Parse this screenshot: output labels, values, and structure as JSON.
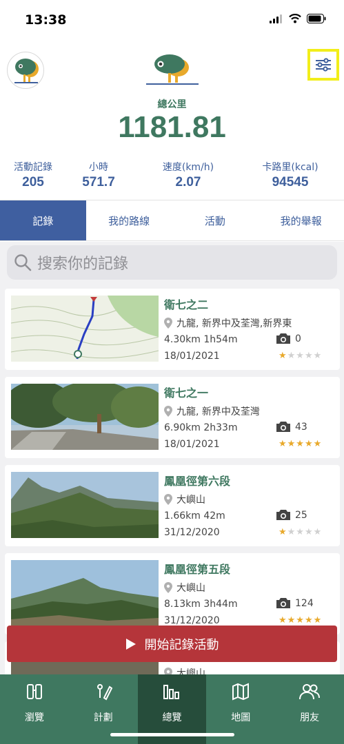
{
  "status": {
    "time": "13:38"
  },
  "summary": {
    "total_label": "總公里",
    "total_value": "1181.81",
    "stats": [
      {
        "label": "活動記錄",
        "value": "205"
      },
      {
        "label": "小時",
        "value": "571.7"
      },
      {
        "label": "速度(km/h)",
        "value": "2.07"
      },
      {
        "label": "卡路里(kcal)",
        "value": "94545"
      }
    ]
  },
  "tabs": [
    "記錄",
    "我的路線",
    "活動",
    "我的舉報"
  ],
  "search": {
    "placeholder": "搜索你的記錄"
  },
  "records": [
    {
      "title": "衛七之二",
      "location": "九龍, 新界中及荃灣,新界東",
      "distance_time": "4.30km  1h54m",
      "photos": "0",
      "date": "18/01/2021",
      "rating": 1
    },
    {
      "title": "衛七之一",
      "location": "九龍, 新界中及荃灣",
      "distance_time": "6.90km  2h33m",
      "photos": "43",
      "date": "18/01/2021",
      "rating": 5
    },
    {
      "title": "鳳凰徑第六段",
      "location": "大嶼山",
      "distance_time": "1.66km  42m",
      "photos": "25",
      "date": "31/12/2020",
      "rating": 1
    },
    {
      "title": "鳳凰徑第五段",
      "location": "大嶼山",
      "distance_time": "8.13km  3h44m",
      "photos": "124",
      "date": "31/12/2020",
      "rating": 5
    },
    {
      "title": "",
      "location": "大嶼山",
      "distance_time": "",
      "photos": "",
      "date": "",
      "rating": 0
    }
  ],
  "start_button": {
    "label": "開始記錄活動"
  },
  "nav": [
    {
      "label": "瀏覽",
      "icon": "browse-icon"
    },
    {
      "label": "計劃",
      "icon": "plan-icon"
    },
    {
      "label": "總覽",
      "icon": "overview-icon"
    },
    {
      "label": "地圖",
      "icon": "map-icon"
    },
    {
      "label": "朋友",
      "icon": "friends-icon"
    }
  ],
  "colors": {
    "green": "#3f7860",
    "blue": "#3e5f9c",
    "red": "#b5353a",
    "star": "#e8a92b"
  }
}
